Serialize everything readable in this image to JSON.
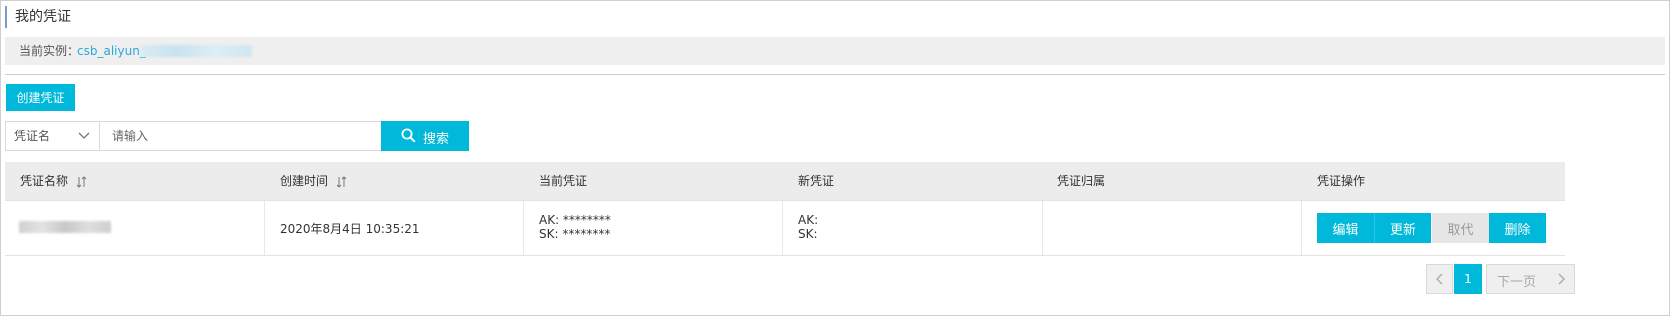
{
  "page": {
    "title": "我的凭证"
  },
  "instance": {
    "label": "当前实例：",
    "value": "csb_aliyun_"
  },
  "toolbar": {
    "create_label": "创建凭证"
  },
  "search": {
    "field_select": "凭证名",
    "placeholder": "请输入",
    "button_label": "搜索"
  },
  "table": {
    "headers": [
      "凭证名称",
      "创建时间",
      "当前凭证",
      "新凭证",
      "凭证归属",
      "凭证操作"
    ],
    "rows": [
      {
        "name": "",
        "created": "2020年8月4日 10:35:21",
        "current_ak": "AK: ********",
        "current_sk": "SK: ********",
        "new_ak": "AK:",
        "new_sk": "SK:",
        "owner": "",
        "actions": [
          "编辑",
          "更新",
          "取代",
          "删除"
        ]
      }
    ]
  },
  "pagination": {
    "current": "1",
    "next_label": "下一页"
  },
  "colors": {
    "accent": "#00b8d9",
    "link": "#2aa8d8",
    "header_bg": "#ececec"
  },
  "icons": [
    "chevron-down-icon",
    "search-icon",
    "sort-icon",
    "chevron-left-icon",
    "chevron-right-icon"
  ]
}
